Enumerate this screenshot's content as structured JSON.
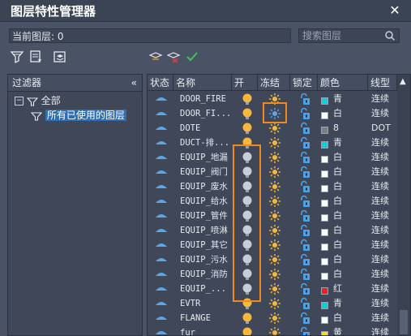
{
  "window": {
    "title": "图层特性管理器",
    "close_glyph": "✕"
  },
  "current_layer": "当前图层: 0",
  "search": {
    "placeholder": "搜索图层"
  },
  "filter_panel": {
    "header": "过滤器",
    "collapse_glyph": "«",
    "tree": [
      {
        "label": "全部",
        "expander": "−"
      },
      {
        "label": "所有已使用的图层",
        "selected": true
      }
    ]
  },
  "columns": [
    "状态",
    "名称",
    "开",
    "冻结",
    "锁定",
    "颜色",
    "线型"
  ],
  "colors": {
    "accent": "#f08a1c",
    "bulb_on": "#f5b83d",
    "bulb_off": "#c8ccd6",
    "selection": "#2f6fb1",
    "state_icon": "#5aa6e6"
  },
  "layers": [
    {
      "name": "DOOR_FIRE",
      "on": true,
      "color_name": "青",
      "color_hex": "#00d4e0",
      "linetype": "连续"
    },
    {
      "name": "DOOR_FI...",
      "on": true,
      "color_name": "白",
      "color_hex": "#ffffff",
      "linetype": "连续",
      "frozen_highlighted": true
    },
    {
      "name": "DOTE",
      "on": true,
      "color_name": "8",
      "color_hex": "#808080",
      "linetype": "DOT"
    },
    {
      "name": "DUCT-排...",
      "on": true,
      "color_name": "青",
      "color_hex": "#00d4e0",
      "linetype": "连续"
    },
    {
      "name": "EQUIP_地漏",
      "on": false,
      "color_name": "白",
      "color_hex": "#ffffff",
      "linetype": "连续"
    },
    {
      "name": "EQUIP_阀门",
      "on": false,
      "color_name": "白",
      "color_hex": "#ffffff",
      "linetype": "连续"
    },
    {
      "name": "EQUIP_废水",
      "on": false,
      "color_name": "白",
      "color_hex": "#ffffff",
      "linetype": "连续"
    },
    {
      "name": "EQUIP_给水",
      "on": false,
      "color_name": "白",
      "color_hex": "#ffffff",
      "linetype": "连续"
    },
    {
      "name": "EQUIP_管件",
      "on": false,
      "color_name": "白",
      "color_hex": "#ffffff",
      "linetype": "连续"
    },
    {
      "name": "EQUIP_喷淋",
      "on": false,
      "color_name": "白",
      "color_hex": "#ffffff",
      "linetype": "连续"
    },
    {
      "name": "EQUIP_其它",
      "on": false,
      "color_name": "白",
      "color_hex": "#ffffff",
      "linetype": "连续"
    },
    {
      "name": "EQUIP_污水",
      "on": false,
      "color_name": "白",
      "color_hex": "#ffffff",
      "linetype": "连续"
    },
    {
      "name": "EQUIP_消防",
      "on": false,
      "color_name": "白",
      "color_hex": "#ffffff",
      "linetype": "连续"
    },
    {
      "name": "EQUIP_...",
      "on": false,
      "color_name": "红",
      "color_hex": "#ff1a1a",
      "linetype": "连续"
    },
    {
      "name": "EVTR",
      "on": true,
      "color_name": "青",
      "color_hex": "#00d4e0",
      "linetype": "连续"
    },
    {
      "name": "FLANGE",
      "on": true,
      "color_name": "白",
      "color_hex": "#ffffff",
      "linetype": "连续"
    },
    {
      "name": "fur",
      "on": true,
      "color_name": "黄",
      "color_hex": "#ffe000",
      "linetype": "连续"
    }
  ]
}
